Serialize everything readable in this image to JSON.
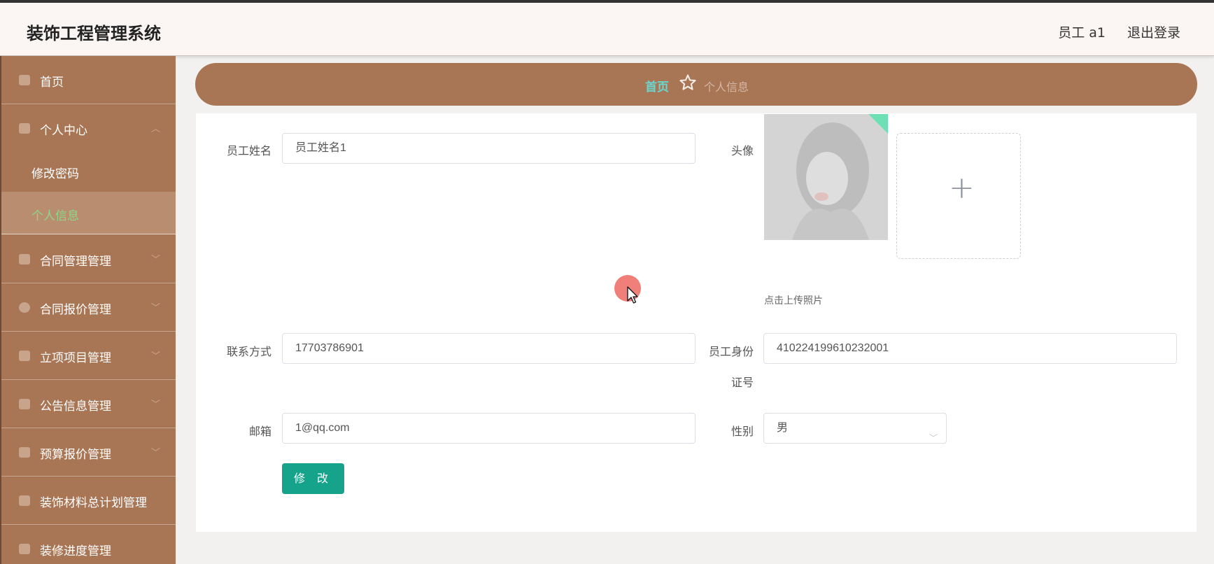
{
  "app": {
    "title": "装饰工程管理系统"
  },
  "header": {
    "user": "员工 a1",
    "logout": "退出登录"
  },
  "sidebar": {
    "items": [
      {
        "label": "首页",
        "icon": "home-icon"
      },
      {
        "label": "个人中心",
        "icon": "user-icon",
        "expanded": true
      },
      {
        "label": "合同管理管理",
        "icon": "list-icon"
      },
      {
        "label": "合同报价管理",
        "icon": "circle-icon"
      },
      {
        "label": "立项项目管理",
        "icon": "doc-icon"
      },
      {
        "label": "公告信息管理",
        "icon": "flag-icon"
      },
      {
        "label": "预算报价管理",
        "icon": "table-icon"
      },
      {
        "label": "装饰材料总计划管理",
        "icon": "chart-icon"
      },
      {
        "label": "装修进度管理",
        "icon": "monitor-icon"
      }
    ],
    "subitems": [
      {
        "label": "修改密码"
      },
      {
        "label": "个人信息",
        "active": true
      }
    ]
  },
  "breadcrumb": {
    "home": "首页",
    "current": "个人信息"
  },
  "form": {
    "name_label": "员工姓名",
    "name_value": "员工姓名1",
    "avatar_label": "头像",
    "upload_hint": "点击上传照片",
    "phone_label": "联系方式",
    "phone_value": "17703786901",
    "id_label_line1": "员工身份",
    "id_label_line2": "证号",
    "id_value": "410224199610232001",
    "email_label": "邮箱",
    "email_value": "1@qq.com",
    "gender_label": "性别",
    "gender_value": "男",
    "submit_label": "修 改"
  },
  "colors": {
    "sidebar_bg": "#a97655",
    "accent_teal": "#16a38b",
    "active_menu_text": "#8ed78a",
    "breadcrumb_home": "#6ad6d0"
  }
}
